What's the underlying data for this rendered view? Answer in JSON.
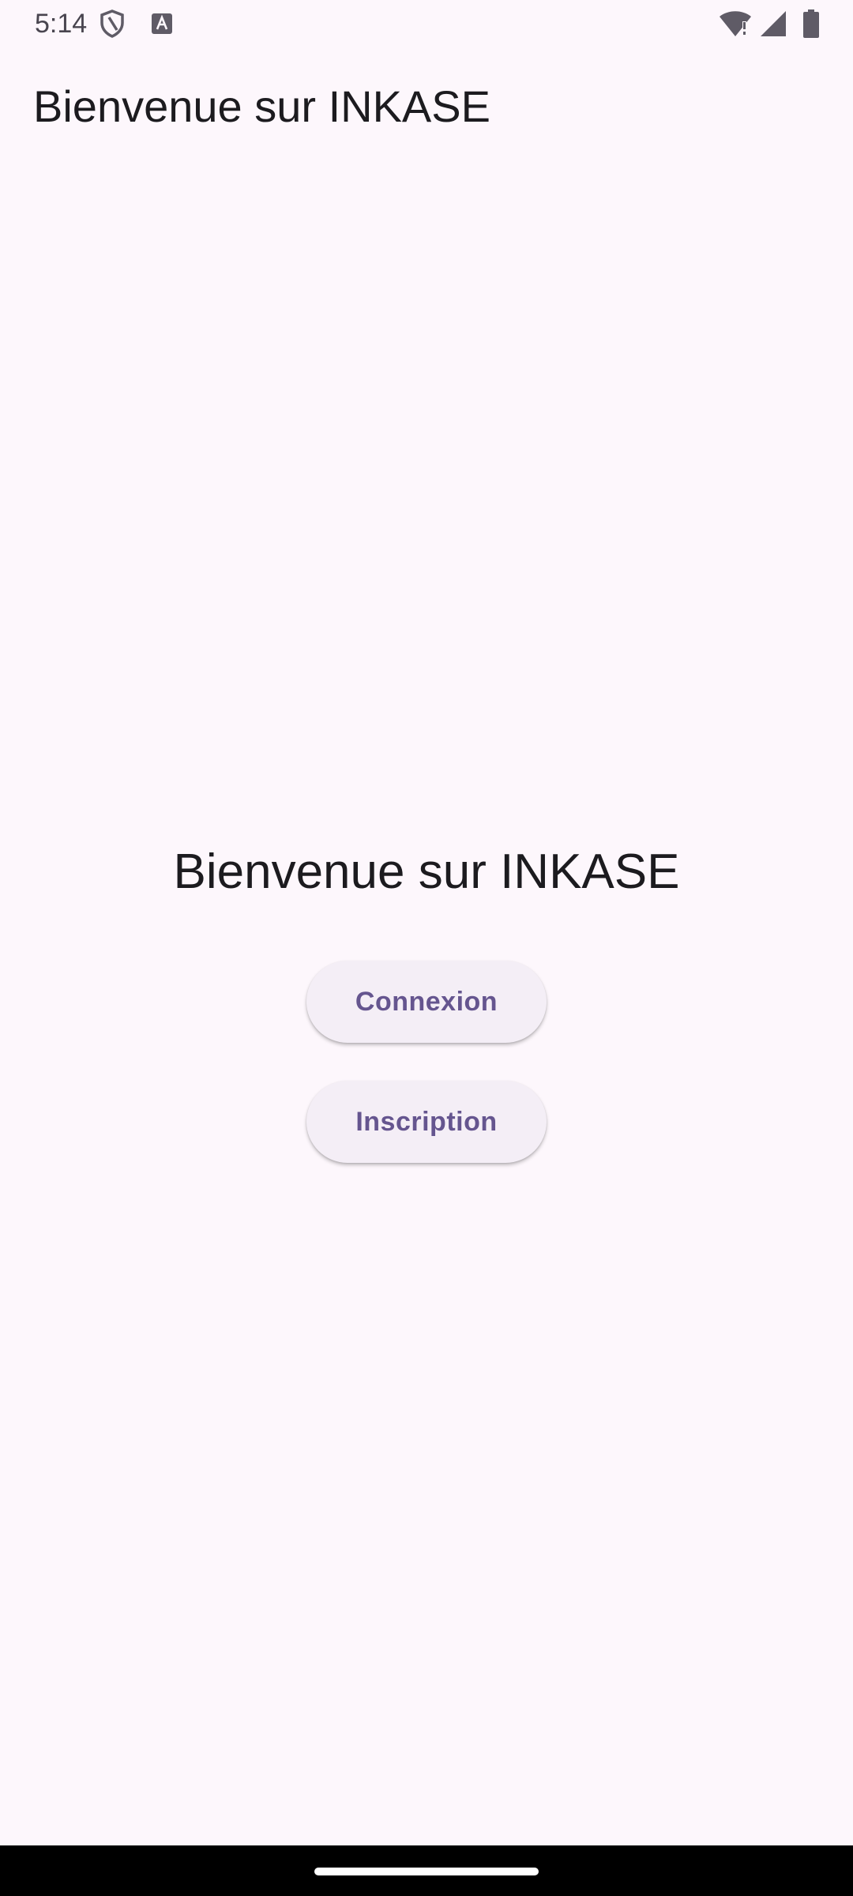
{
  "status_bar": {
    "time": "5:14",
    "icons": [
      "shield-icon",
      "keyboard-a-icon",
      "wifi-alert-icon",
      "signal-icon",
      "battery-icon"
    ]
  },
  "app_bar": {
    "title": "Bienvenue sur INKASE"
  },
  "main": {
    "headline": "Bienvenue sur INKASE",
    "login_label": "Connexion",
    "signup_label": "Inscription"
  },
  "colors": {
    "background": "#fdf7fc",
    "button_surface": "#f4eef6",
    "button_text": "#65558f",
    "text_primary": "#1c1b1f",
    "nav_bar": "#000000"
  }
}
